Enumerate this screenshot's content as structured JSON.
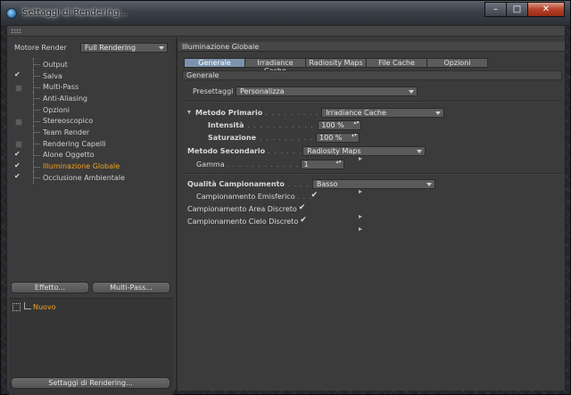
{
  "window": {
    "title": "Settaggi di Rendering...",
    "min": "–",
    "max": "□",
    "close": "✕"
  },
  "left": {
    "renderer_label": "Motore Render",
    "renderer_value": "Full Rendering",
    "items": [
      {
        "label": "Output",
        "check": "none",
        "active": false
      },
      {
        "label": "Salva",
        "check": "on",
        "active": false
      },
      {
        "label": "Multi-Pass",
        "check": "box",
        "active": false
      },
      {
        "label": "Anti-Aliasing",
        "check": "none",
        "active": false
      },
      {
        "label": "Opzioni",
        "check": "none",
        "active": false
      },
      {
        "label": "Stereoscopico",
        "check": "box",
        "active": false
      },
      {
        "label": "Team Render",
        "check": "none",
        "active": false
      },
      {
        "label": "Rendering Capelli",
        "check": "box",
        "active": false
      },
      {
        "label": "Alone Oggetto",
        "check": "on",
        "active": false
      },
      {
        "label": "Illuminazione Globale",
        "check": "on",
        "active": true
      },
      {
        "label": "Occlusione Ambientale",
        "check": "on",
        "active": false
      }
    ],
    "effect_button": "Effetto...",
    "multipass_button": "Multi-Pass...",
    "preset_item": "Nuovo",
    "settings_button": "Settaggi di Rendering..."
  },
  "right": {
    "section_title": "Illuminazione Globale",
    "tabs": [
      "Generale",
      "Irradiance Cache",
      "Radiosity Maps",
      "File Cache",
      "Opzioni"
    ],
    "active_tab": 0,
    "group_title": "Generale",
    "preset_label": "Presettaggi",
    "preset_value": "Personalizza",
    "primary_label": "Metodo Primario",
    "primary_dots": ". . . . . . . . . . .",
    "primary_value": "Irradiance Cache",
    "intensity_label": "Intensità",
    "intensity_dots": ". . . . . . . . . . . . .",
    "intensity_value": "100 %",
    "saturation_label": "Saturazione",
    "saturation_dots": ". . . . . . . . . . .",
    "saturation_value": "100 %",
    "secondary_label": "Metodo Secondario",
    "secondary_dots": ". . . . . . . .",
    "secondary_value": "Radiosity Maps",
    "gamma_label": "Gamma",
    "gamma_dots": ". . . . . . . . . . . . . . . . . . .",
    "gamma_value": "1",
    "quality_label": "Qualità Campionamento",
    "quality_dots": ". . . . .",
    "quality_value": "Basso",
    "hemi_label": "Campionamento Emisferico",
    "hemi_dots": ". . .",
    "area_label": "Campionamento Area Discreto",
    "sky_label": "Campionamento Cielo Discreto",
    "spin_glyph": "▴▾"
  }
}
